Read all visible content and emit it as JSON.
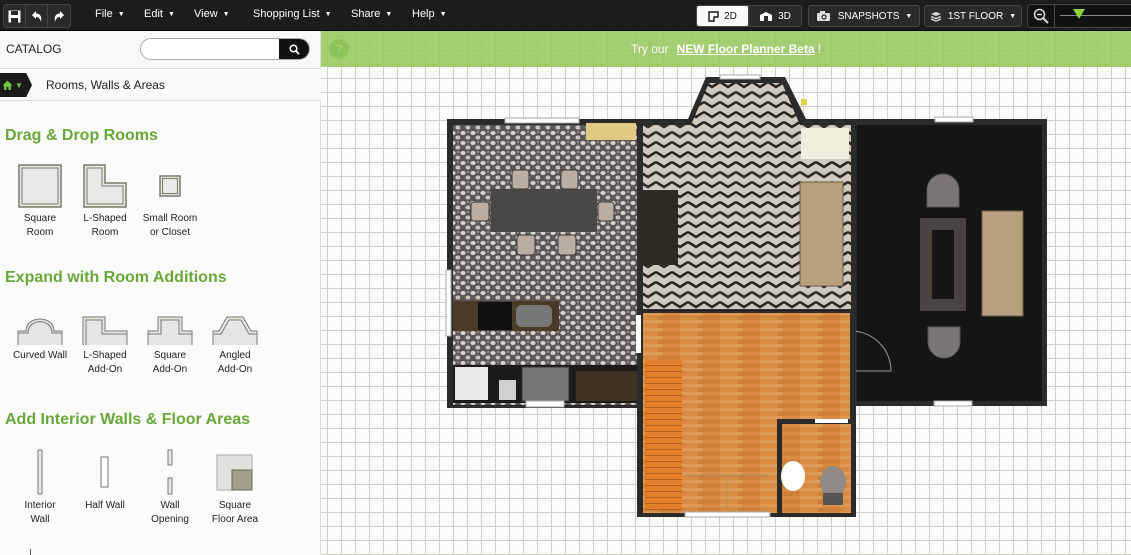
{
  "toolbar": {
    "save_icon": "save-icon",
    "undo_icon": "undo-icon",
    "redo_icon": "redo-icon",
    "menus": [
      {
        "label": "File"
      },
      {
        "label": "Edit"
      },
      {
        "label": "View"
      },
      {
        "label": "Shopping List"
      },
      {
        "label": "Share"
      },
      {
        "label": "Help"
      }
    ],
    "view_2d": "2D",
    "view_3d": "3D",
    "active_view": "2D",
    "snapshots": "SNAPSHOTS",
    "floor": "1ST FLOOR",
    "zoom_level": 0.25
  },
  "sidebar": {
    "catalog_title": "CATALOG",
    "search_placeholder": "",
    "breadcrumb": "Rooms, Walls & Areas",
    "sections": [
      {
        "title": "Drag & Drop Rooms",
        "items": [
          {
            "line1": "Square",
            "line2": "Room"
          },
          {
            "line1": "L-Shaped",
            "line2": "Room"
          },
          {
            "line1": "Small Room",
            "line2": "or Closet"
          }
        ]
      },
      {
        "title": "Expand with Room Additions",
        "items": [
          {
            "line1": "Curved Wall",
            "line2": ""
          },
          {
            "line1": "L-Shaped",
            "line2": "Add-On"
          },
          {
            "line1": "Square",
            "line2": "Add-On"
          },
          {
            "line1": "Angled",
            "line2": "Add-On"
          }
        ]
      },
      {
        "title": "Add Interior Walls & Floor Areas",
        "items": [
          {
            "line1": "Interior",
            "line2": "Wall"
          },
          {
            "line1": "Half Wall",
            "line2": ""
          },
          {
            "line1": "Wall",
            "line2": "Opening"
          },
          {
            "line1": "Square",
            "line2": "Floor Area"
          }
        ]
      }
    ]
  },
  "canvas": {
    "banner_prefix": "Try our",
    "banner_link": "NEW Floor Planner Beta",
    "banner_suffix": "!",
    "help_icon": "?",
    "colors": {
      "accent": "#6aa73a",
      "banner": "#96c85f",
      "wall": "#2b2b2b",
      "wood_floor": "#d98a3e",
      "dark_carpet": "#151515"
    }
  }
}
